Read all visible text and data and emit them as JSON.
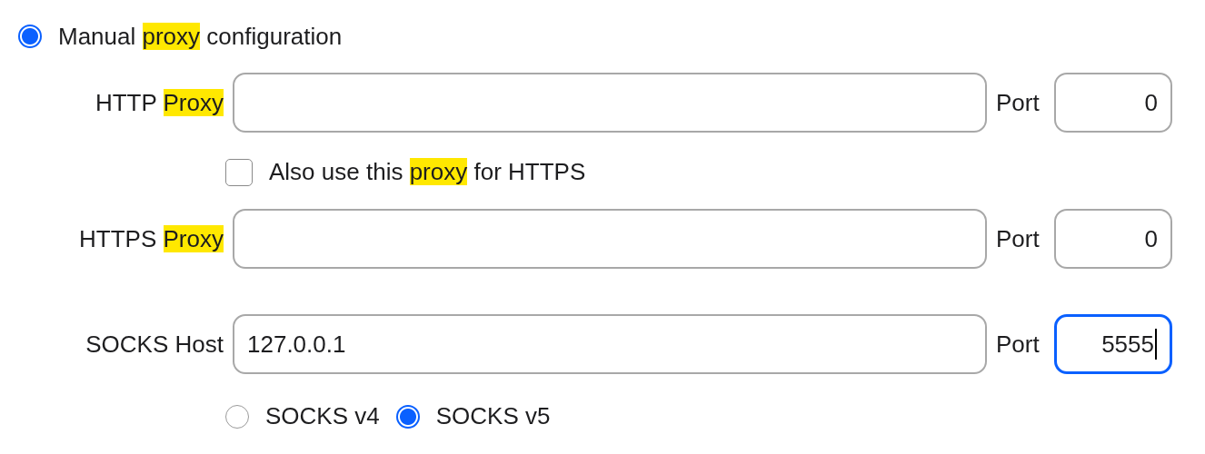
{
  "manual_proxy": {
    "selected": true,
    "label": [
      {
        "text": "Manual "
      },
      {
        "text": "proxy",
        "highlighted": true
      },
      {
        "text": " configuration"
      }
    ]
  },
  "proxies": [
    {
      "kind": "field",
      "label": [
        {
          "text": "HTTP "
        },
        {
          "text": "Proxy",
          "highlighted": true
        }
      ],
      "port_label": "Port",
      "port": {
        "value": "0",
        "focused": false
      }
    },
    {
      "kind": "checkbox",
      "checked": false,
      "label": [
        {
          "text": "Also use this "
        },
        {
          "text": "proxy",
          "highlighted": true
        },
        {
          "text": " for HTTPS"
        }
      ]
    },
    {
      "kind": "field",
      "label": [
        {
          "text": "HTTPS "
        },
        {
          "text": "Proxy",
          "highlighted": true
        }
      ],
      "port_label": "Port",
      "port": {
        "value": "0",
        "focused": false
      }
    }
  ],
  "socks": {
    "label": [
      {
        "text": "SOCKS Host"
      }
    ],
    "host": {
      "value": "127.0.0.1",
      "focused": false
    },
    "port_label": "Port",
    "port": {
      "value": "5555",
      "focused": true
    },
    "versions": [
      {
        "label": "SOCKS v4",
        "selected": false
      },
      {
        "label": "SOCKS v5",
        "selected": true
      }
    ]
  }
}
